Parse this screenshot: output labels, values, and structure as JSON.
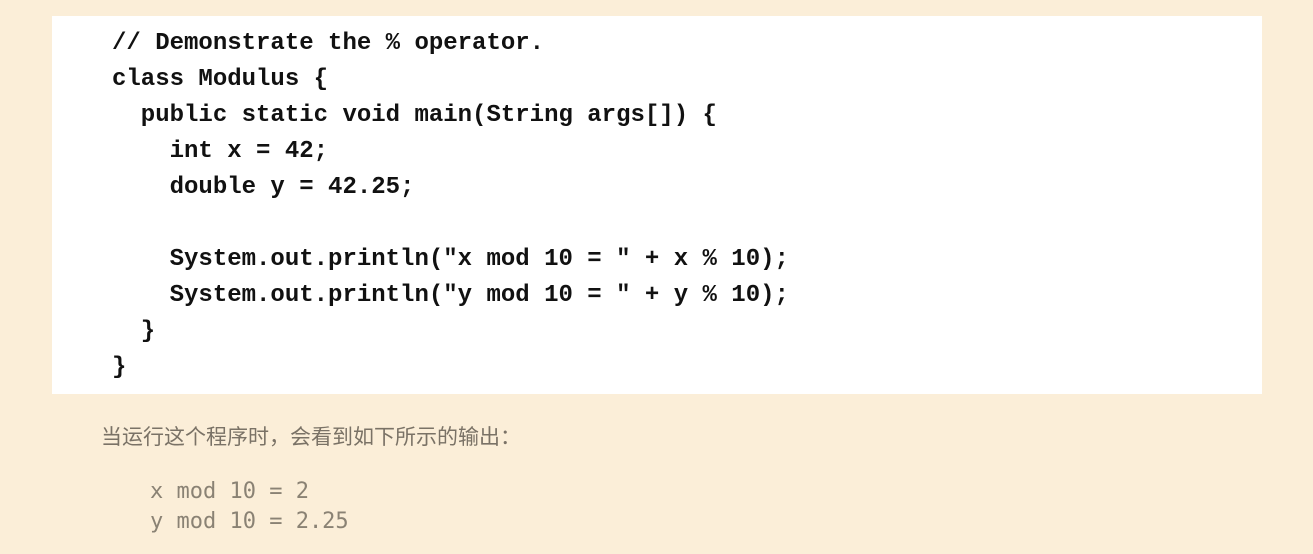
{
  "code": {
    "lines": [
      "// Demonstrate the % operator.",
      "class Modulus {",
      "  public static void main(String args[]) {",
      "    int x = 42;",
      "    double y = 42.25;",
      "",
      "    System.out.println(\"x mod 10 = \" + x % 10);",
      "    System.out.println(\"y mod 10 = \" + y % 10);",
      "  }",
      "}"
    ]
  },
  "prose": {
    "text": "当运行这个程序时，会看到如下所示的输出："
  },
  "output": {
    "lines": [
      "x mod 10 = 2",
      "y mod 10 = 2.25"
    ]
  }
}
